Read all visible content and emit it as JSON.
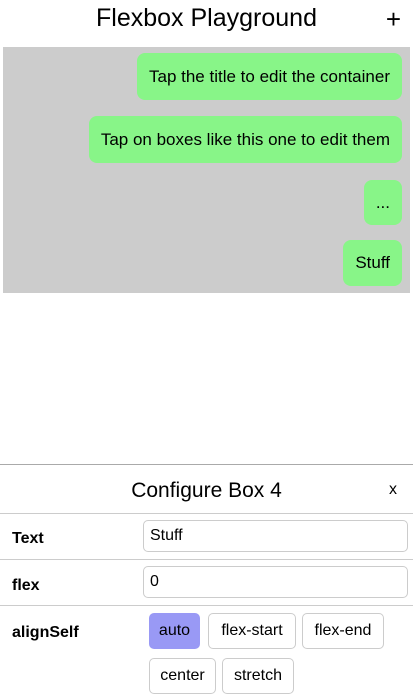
{
  "header": {
    "title": "Flexbox Playground",
    "add_label": "+"
  },
  "container": {
    "background": "#cccccc",
    "boxes": [
      {
        "text": "Tap the title to edit the container"
      },
      {
        "text": "Tap on boxes like this one to edit them"
      },
      {
        "text": "..."
      },
      {
        "text": "Stuff"
      }
    ],
    "box_color": "#88f588"
  },
  "panel": {
    "title": "Configure Box 4",
    "close_label": "x",
    "text": {
      "label": "Text",
      "value": "Stuff"
    },
    "flex": {
      "label": "flex",
      "value": "0"
    },
    "alignSelf": {
      "label": "alignSelf",
      "options": [
        "auto",
        "flex-start",
        "flex-end",
        "center",
        "stretch"
      ],
      "selected": "auto",
      "selected_color": "#9999f5"
    }
  }
}
